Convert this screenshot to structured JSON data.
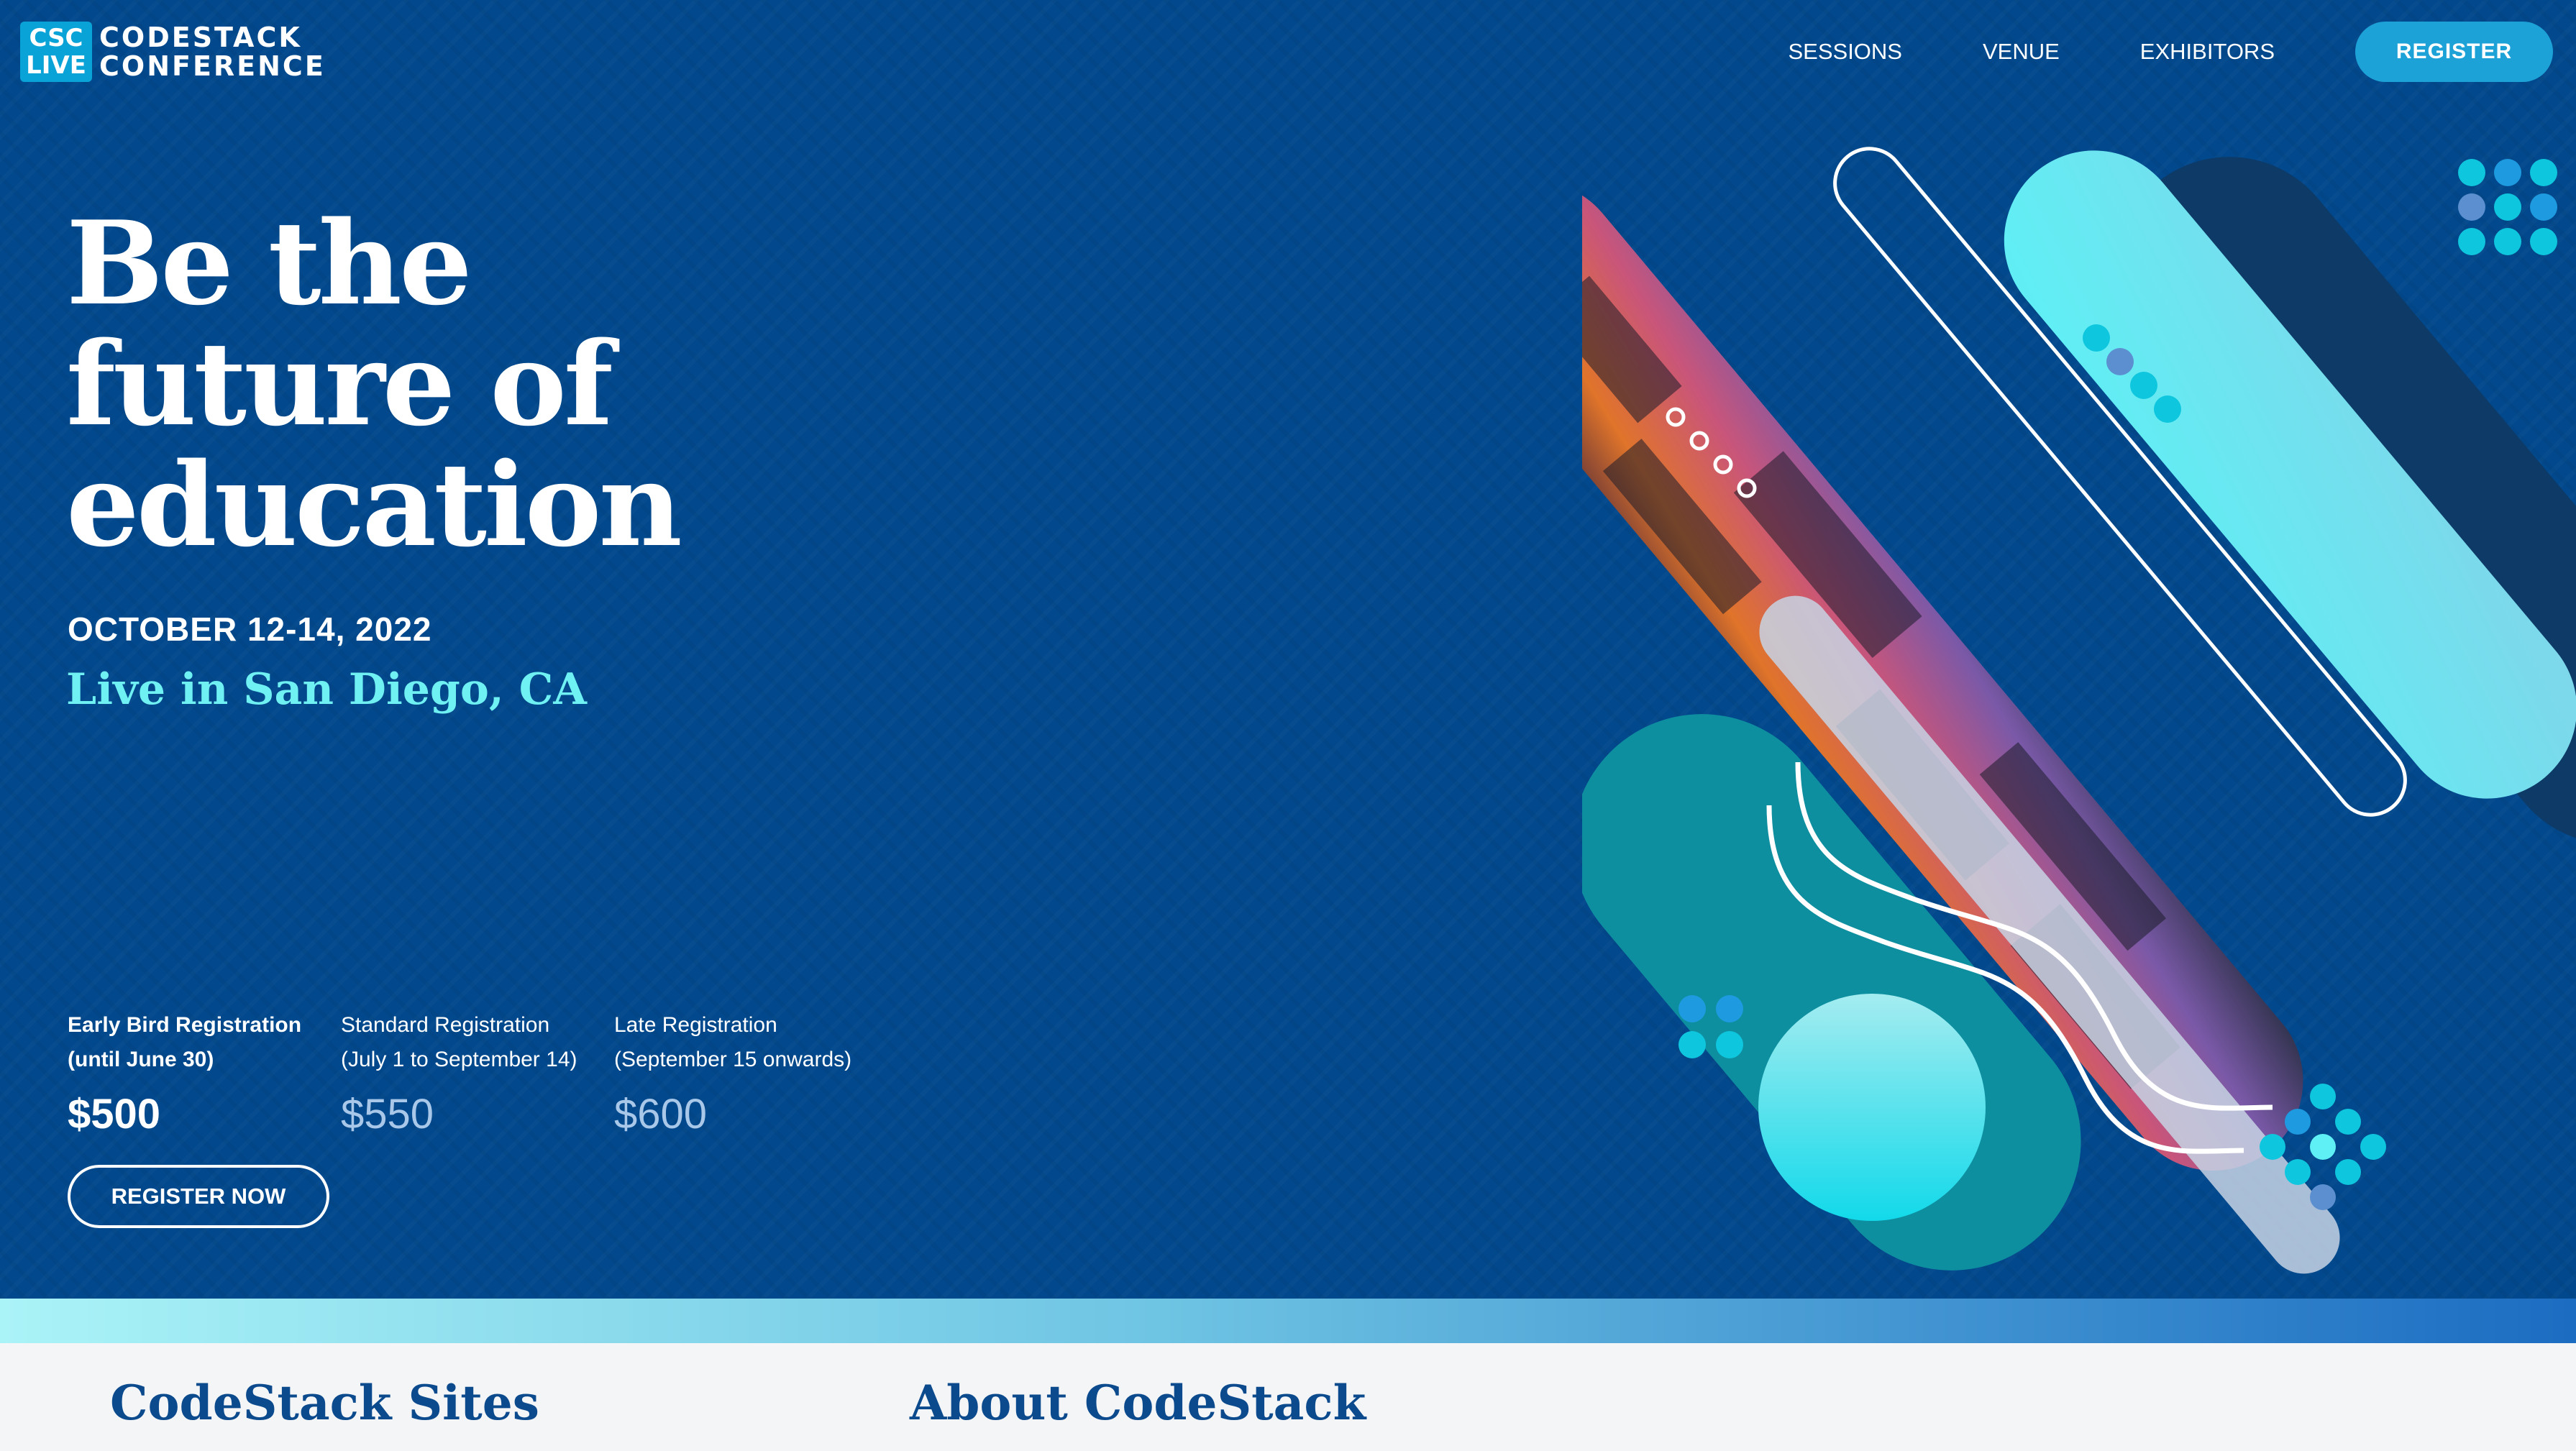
{
  "logo": {
    "abbr_top": "CSC",
    "abbr_bottom": "LIVE",
    "name_top": "CODESTACK",
    "name_bottom": "CONFERENCE"
  },
  "nav": {
    "sessions": "SESSIONS",
    "venue": "VENUE",
    "exhibitors": "EXHIBITORS",
    "register": "REGISTER"
  },
  "hero": {
    "headline_line1": "Be the",
    "headline_line2": "future of",
    "headline_line3": "education",
    "dates": "OCTOBER 12-14, 2022",
    "location": "Live in San Diego, CA",
    "cta": "REGISTER NOW"
  },
  "pricing": [
    {
      "name": "Early Bird Registration",
      "range": "(until June 30)",
      "price": "$500"
    },
    {
      "name": "Standard Registration",
      "range": "(July 1 to September 14)",
      "price": "$550"
    },
    {
      "name": "Late Registration",
      "range": "(September 15 onwards)",
      "price": "$600"
    }
  ],
  "footer": {
    "sites_heading": "CodeStack Sites",
    "about_heading": "About CodeStack"
  },
  "colors": {
    "hero_bg": "#02488c",
    "accent_cyan": "#6ff0f2",
    "button_blue": "#1da2d8",
    "heading_navy": "#0c4a8e"
  }
}
